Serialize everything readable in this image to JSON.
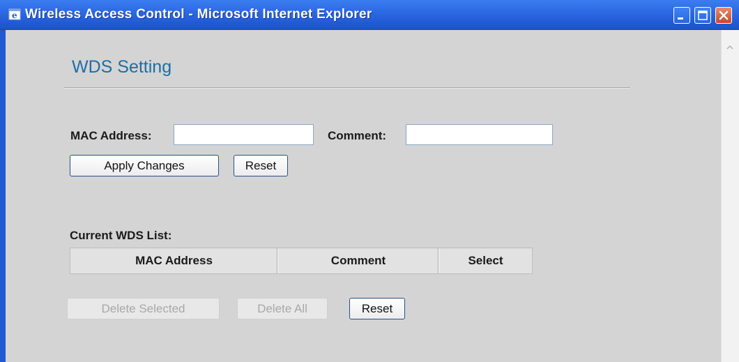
{
  "window": {
    "title": "Wireless Access Control - Microsoft Internet Explorer",
    "controls": [
      "minimize-icon",
      "maximize-icon",
      "close-icon"
    ]
  },
  "page": {
    "title": "WDS Setting"
  },
  "form": {
    "mac_label": "MAC Address:",
    "mac_value": "",
    "comment_label": "Comment:",
    "comment_value": "",
    "apply_label": "Apply Changes",
    "reset_label": "Reset"
  },
  "wds_list": {
    "heading": "Current WDS List:",
    "columns": [
      "MAC Address",
      "Comment",
      "Select"
    ],
    "rows": []
  },
  "actions": {
    "delete_selected_label": "Delete Selected",
    "delete_all_label": "Delete All",
    "reset_label": "Reset"
  },
  "colors": {
    "titlebar": "#2d6ae3",
    "content_bg": "#d4d4d4",
    "page_title": "#1a6fa8"
  }
}
